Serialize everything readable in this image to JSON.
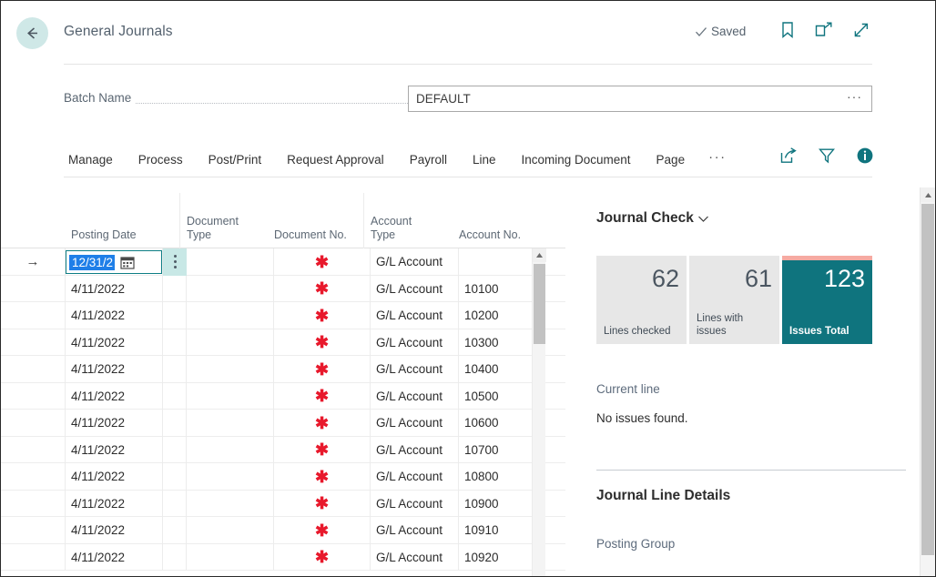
{
  "window": {
    "title": "General Journals",
    "back_icon": "arrow-left-icon",
    "saved_status": "Saved",
    "saved_icon": "checkmark-icon",
    "top_icons": [
      "bookmark-icon",
      "open-in-new-window-icon",
      "expand-icon"
    ],
    "accent_color": "#0f747e",
    "back_button_bg": "#cfe8e7"
  },
  "batch": {
    "label": "Batch Name",
    "value": "DEFAULT",
    "placeholder": "",
    "lookup_label": "···",
    "lookup_icon": "ellipsis-lookup-icon"
  },
  "ribbon": {
    "items": [
      {
        "label": "Manage"
      },
      {
        "label": "Process"
      },
      {
        "label": "Post/Print"
      },
      {
        "label": "Request Approval"
      },
      {
        "label": "Payroll"
      },
      {
        "label": "Line"
      },
      {
        "label": "Incoming Document"
      },
      {
        "label": "Page"
      }
    ],
    "overflow_label": "···",
    "icons": [
      "share-icon",
      "filter-icon",
      "info-icon"
    ]
  },
  "grid": {
    "columns": [
      {
        "key": "indicator",
        "header": ""
      },
      {
        "key": "posting_date",
        "header": "Posting Date"
      },
      {
        "key": "rowmenu",
        "header": ""
      },
      {
        "key": "document_type",
        "header": "Document\nType"
      },
      {
        "key": "document_no",
        "header": "Document No."
      },
      {
        "key": "account_type",
        "header": "Account\nType"
      },
      {
        "key": "account_no",
        "header": "Account No."
      }
    ],
    "column_headers": {
      "posting_date": "Posting Date",
      "document_type_line1": "Document",
      "document_type_line2": "Type",
      "document_no": "Document No.",
      "account_type_line1": "Account",
      "account_type_line2": "Type",
      "account_no": "Account No."
    },
    "selected_row_index": 0,
    "selected_cell": {
      "column": "posting_date",
      "editing_value": "12/31/2",
      "text_selected": true,
      "calendar_icon": "calendar-icon",
      "row_menu_icon": "vertical-dots-icon",
      "indicator_icon": "arrow-right-icon"
    },
    "required_marker": "✱",
    "rows": [
      {
        "indicator": "→",
        "posting_date": "12/31/2",
        "document_type": "",
        "document_no": "✱",
        "account_type": "G/L Account",
        "account_no": ""
      },
      {
        "indicator": "",
        "posting_date": "4/11/2022",
        "document_type": "",
        "document_no": "✱",
        "account_type": "G/L Account",
        "account_no": "10100"
      },
      {
        "indicator": "",
        "posting_date": "4/11/2022",
        "document_type": "",
        "document_no": "✱",
        "account_type": "G/L Account",
        "account_no": "10200"
      },
      {
        "indicator": "",
        "posting_date": "4/11/2022",
        "document_type": "",
        "document_no": "✱",
        "account_type": "G/L Account",
        "account_no": "10300"
      },
      {
        "indicator": "",
        "posting_date": "4/11/2022",
        "document_type": "",
        "document_no": "✱",
        "account_type": "G/L Account",
        "account_no": "10400"
      },
      {
        "indicator": "",
        "posting_date": "4/11/2022",
        "document_type": "",
        "document_no": "✱",
        "account_type": "G/L Account",
        "account_no": "10500"
      },
      {
        "indicator": "",
        "posting_date": "4/11/2022",
        "document_type": "",
        "document_no": "✱",
        "account_type": "G/L Account",
        "account_no": "10600"
      },
      {
        "indicator": "",
        "posting_date": "4/11/2022",
        "document_type": "",
        "document_no": "✱",
        "account_type": "G/L Account",
        "account_no": "10700"
      },
      {
        "indicator": "",
        "posting_date": "4/11/2022",
        "document_type": "",
        "document_no": "✱",
        "account_type": "G/L Account",
        "account_no": "10800"
      },
      {
        "indicator": "",
        "posting_date": "4/11/2022",
        "document_type": "",
        "document_no": "✱",
        "account_type": "G/L Account",
        "account_no": "10900"
      },
      {
        "indicator": "",
        "posting_date": "4/11/2022",
        "document_type": "",
        "document_no": "✱",
        "account_type": "G/L Account",
        "account_no": "10910"
      },
      {
        "indicator": "",
        "posting_date": "4/11/2022",
        "document_type": "",
        "document_no": "✱",
        "account_type": "G/L Account",
        "account_no": "10920"
      }
    ]
  },
  "factbox": {
    "journal_check": {
      "title": "Journal Check",
      "expander_icon": "chevron-down-icon",
      "tiles": [
        {
          "value": "62",
          "label": "Lines checked",
          "style": "neutral"
        },
        {
          "value": "61",
          "label": "Lines with issues",
          "style": "neutral"
        },
        {
          "value": "123",
          "label": "Issues Total",
          "style": "accent",
          "accent_bar_color": "#f6aaa2",
          "bg_color": "#0f747e"
        }
      ],
      "current_line_label": "Current line",
      "current_line_value": "No issues found."
    },
    "journal_line_details": {
      "title": "Journal Line Details",
      "fields": [
        {
          "label": "Posting Group"
        }
      ]
    }
  },
  "scrollbars": {
    "grid_up_icon": "scroll-up-arrow-icon",
    "page_up_icon": "scroll-up-arrow-icon"
  }
}
